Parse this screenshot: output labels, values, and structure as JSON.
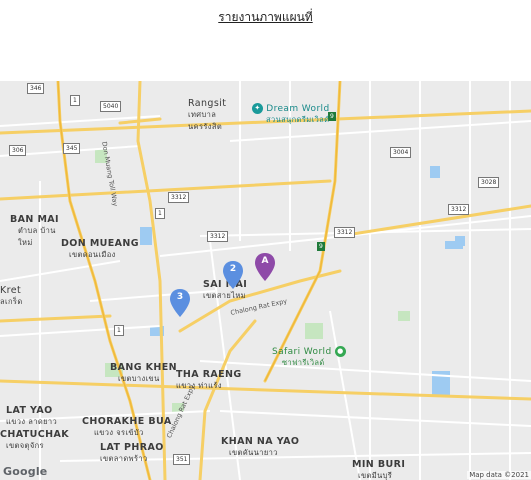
{
  "page": {
    "title": "รายงานภาพแผนที่"
  },
  "map": {
    "areas": [
      {
        "en": "Rangsit",
        "th": "เทศบาล นครรังสิต"
      },
      {
        "en": "BAN MAI",
        "th": "ตำบล บ้านใหม่"
      },
      {
        "en": "DON MUEANG",
        "th": "เขตดอนเมือง"
      },
      {
        "en": "SAI MAI",
        "th": "เขตสายไหม"
      },
      {
        "en": "Kret",
        "th": "ลเกร็ด"
      },
      {
        "en": "BANG KHEN",
        "th": "เขตบางเขน"
      },
      {
        "en": "THA RAENG",
        "th": "แขวง ท่าแร้ง"
      },
      {
        "en": "LAT YAO",
        "th": "แขวง ลาดยาว"
      },
      {
        "en": "CHATUCHAK",
        "th": "เขตจตุจักร"
      },
      {
        "en": "CHORAKHE BUA",
        "th": "แขวง จรเข้บัว"
      },
      {
        "en": "LAT PHRAO",
        "th": "เขตลาดพร้าว"
      },
      {
        "en": "KHAN NA YAO",
        "th": "เขตคันนายาว"
      },
      {
        "en": "MIN BURI",
        "th": "เขตมีนบุรี"
      }
    ],
    "pois": [
      {
        "name": "Dream World",
        "th": "สวนสนุกดรีมเวิลด์",
        "icon": "amusement-park-icon",
        "color": "#1a8a8a"
      },
      {
        "name": "Safari World",
        "th": "ซาฟารีเวิลด์",
        "icon": "zoo-icon",
        "color": "#2f8a42"
      }
    ],
    "road_names": [
      "Don Muang Toll Way",
      "Chalong Rat Expy",
      "Chalong Rat Expy"
    ],
    "route_shields": [
      "346",
      "1",
      "5040",
      "306",
      "345",
      "1",
      "3312",
      "3312",
      "3312",
      "3312",
      "1",
      "351",
      "3004",
      "3028",
      "9",
      "9"
    ],
    "markers": [
      {
        "label": "A",
        "color": "#8e4aa8"
      },
      {
        "label": "2",
        "color": "#5b8fe0"
      },
      {
        "label": "3",
        "color": "#5b8fe0"
      }
    ],
    "google_logo": "Google",
    "copyright": "Map data ©2021"
  }
}
